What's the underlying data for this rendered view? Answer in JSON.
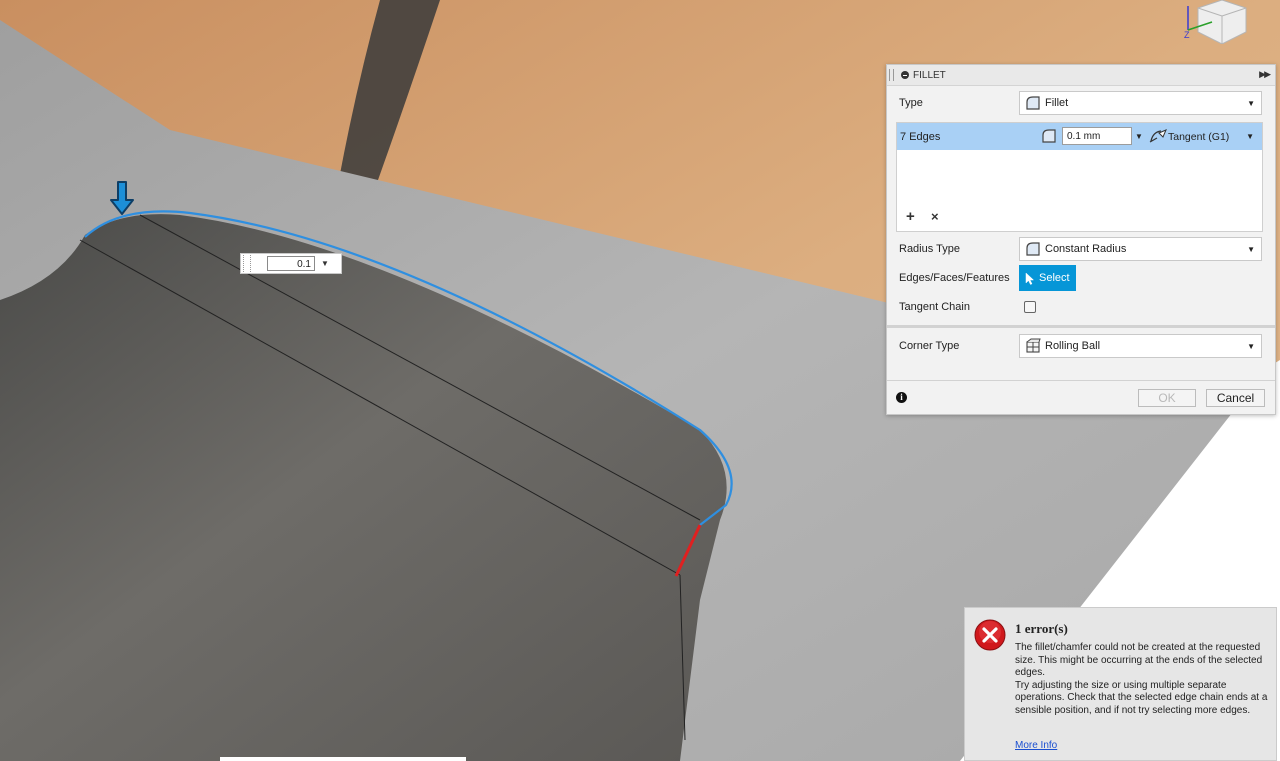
{
  "canvas": {
    "radius_input": {
      "value": "0.1"
    }
  },
  "fillet_panel": {
    "title": "FILLET",
    "type": {
      "label": "Type",
      "value": "Fillet"
    },
    "edges": {
      "count_label": "7 Edges",
      "radius": "0.1 mm",
      "continuity": "Tangent (G1)"
    },
    "radius_type": {
      "label": "Radius Type",
      "value": "Constant Radius"
    },
    "selection": {
      "label": "Edges/Faces/Features",
      "button": "Select"
    },
    "tangent_chain": {
      "label": "Tangent Chain",
      "checked": false
    },
    "corner_type": {
      "label": "Corner Type",
      "value": "Rolling Ball"
    },
    "ok_label": "OK",
    "cancel_label": "Cancel",
    "add_symbol": "+",
    "remove_symbol": "×"
  },
  "error_popup": {
    "title": "1 error(s)",
    "message": "  The fillet/chamfer could not be created at the requested size. This might be occurring at the ends of the selected edges.\n     Try adjusting the size or using multiple separate operations. Check that the selected edge chain ends at a sensible position, and if not try selecting more edges.",
    "link": "More Info"
  },
  "colors": {
    "accent": "#0696d7",
    "selected_row": "#a9d0f5",
    "selected_edge": "#2f8fe0",
    "error_edge": "#e02020",
    "error_icon": "#d0181c"
  },
  "icons": [
    "fillet-icon",
    "tangent-icon",
    "rolling-ball-icon",
    "select-cursor-icon",
    "info-icon",
    "error-icon",
    "pin-arrow-icon",
    "viewcube-icon"
  ]
}
